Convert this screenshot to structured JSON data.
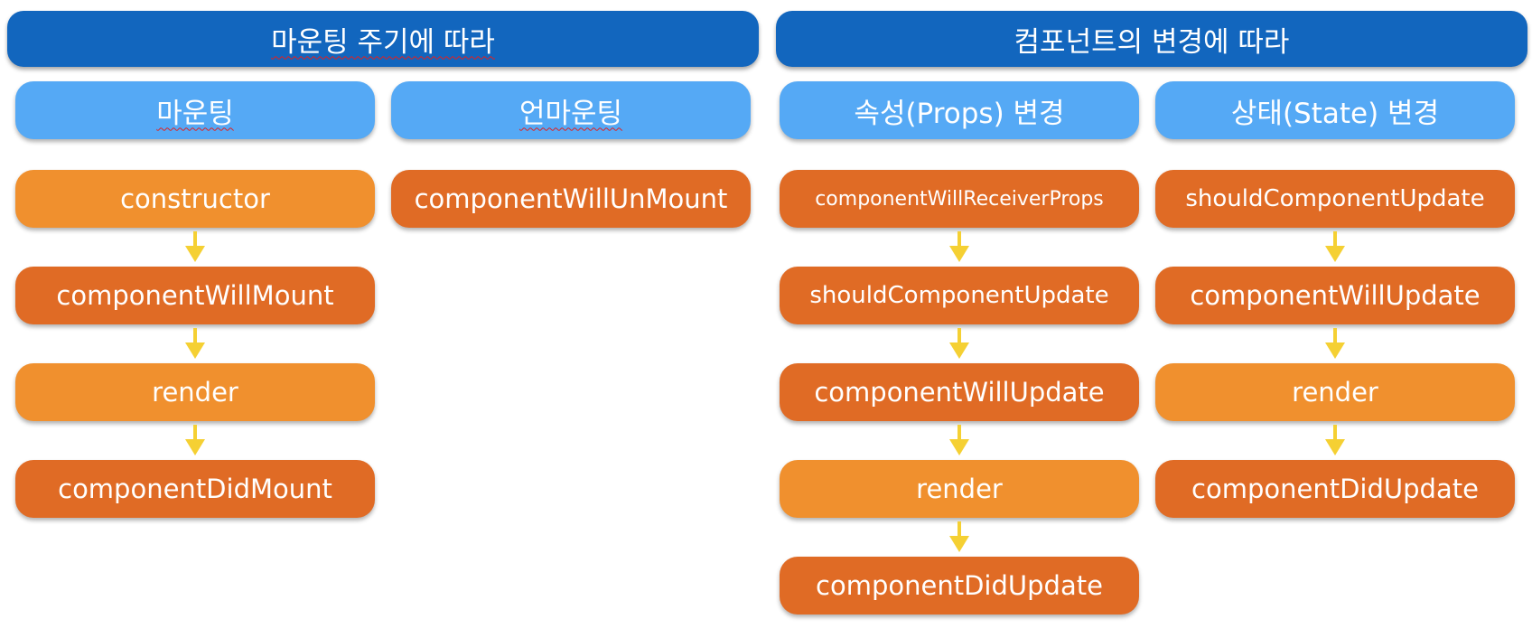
{
  "headers": {
    "mounting_cycle": "마운팅 주기에 따라",
    "component_change": "컴포넌트의 변경에 따라"
  },
  "columns": [
    {
      "title": "마운팅",
      "steps": [
        "constructor",
        "componentWillMount",
        "render",
        "componentDidMount"
      ]
    },
    {
      "title": "언마운팅",
      "steps": [
        "componentWillUnMount"
      ]
    },
    {
      "title": "속성(Props) 변경",
      "steps": [
        "componentWillReceiverProps",
        "shouldComponentUpdate",
        "componentWillUpdate",
        "render",
        "componentDidUpdate"
      ]
    },
    {
      "title": "상태(State) 변경",
      "steps": [
        "shouldComponentUpdate",
        "componentWillUpdate",
        "render",
        "componentDidUpdate"
      ]
    }
  ],
  "colors": {
    "header": "#1266be",
    "subheader": "#55a9f5",
    "step_dark": "#e06b25",
    "step_light": "#f0902e",
    "arrow": "#f5d033"
  }
}
